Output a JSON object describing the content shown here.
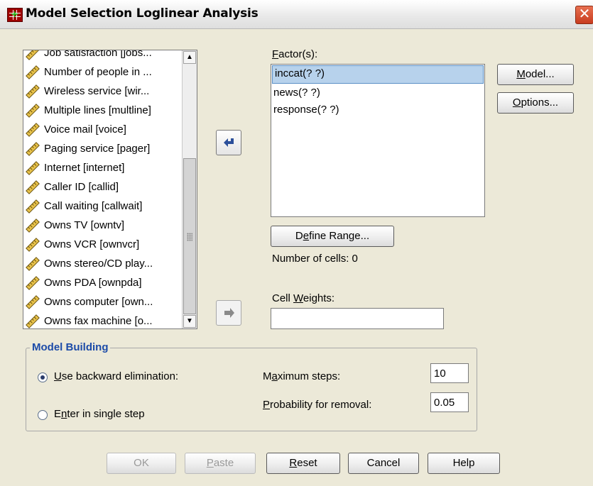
{
  "window": {
    "title": "Model Selection Loglinear Analysis",
    "close_glyph": "✕"
  },
  "variables": [
    {
      "label": "Job satisfaction [jobs...",
      "icon": "ruler-icon"
    },
    {
      "label": "Number of people in ...",
      "icon": "ruler-icon"
    },
    {
      "label": "Wireless service [wir...",
      "icon": "ruler-icon"
    },
    {
      "label": "Multiple lines [multline]",
      "icon": "ruler-icon"
    },
    {
      "label": "Voice mail [voice]",
      "icon": "ruler-icon"
    },
    {
      "label": "Paging service [pager]",
      "icon": "ruler-icon"
    },
    {
      "label": "Internet [internet]",
      "icon": "ruler-icon"
    },
    {
      "label": "Caller ID [callid]",
      "icon": "ruler-icon"
    },
    {
      "label": "Call waiting [callwait]",
      "icon": "ruler-icon"
    },
    {
      "label": "Owns TV [owntv]",
      "icon": "ruler-icon"
    },
    {
      "label": "Owns VCR [ownvcr]",
      "icon": "ruler-icon"
    },
    {
      "label": "Owns stereo/CD play...",
      "icon": "ruler-icon"
    },
    {
      "label": "Owns PDA [ownpda]",
      "icon": "ruler-icon"
    },
    {
      "label": "Owns computer [own...",
      "icon": "ruler-icon"
    },
    {
      "label": "Owns fax machine [o...",
      "icon": "ruler-icon"
    }
  ],
  "factors": {
    "label_mnemonic": "F",
    "label_rest": "actor(s):",
    "items": [
      "inccat(? ?)",
      "news(? ?)",
      "response(? ?)"
    ],
    "selected_index": 0
  },
  "define_range": {
    "pre": "D",
    "mn": "e",
    "post": "fine Range..."
  },
  "cells": {
    "text": "Number of cells:  0"
  },
  "cell_weights": {
    "pre": "Cell ",
    "mn": "W",
    "post": "eights:",
    "value": ""
  },
  "side_buttons": {
    "model": {
      "mn": "M",
      "post": "odel..."
    },
    "options": {
      "mn": "O",
      "post": "ptions..."
    }
  },
  "model_building": {
    "title": "Model Building",
    "backward": {
      "mn": "U",
      "post": "se backward elimination:",
      "selected": true
    },
    "single": {
      "pre": "E",
      "mn": "n",
      "post": "ter in single step",
      "selected": false
    },
    "max_steps": {
      "pre": "M",
      "mn": "a",
      "post": "ximum steps:",
      "value": "10"
    },
    "prob_removal": {
      "mn": "P",
      "post": "robability for removal:",
      "value": "0.05"
    }
  },
  "bottom_buttons": {
    "ok": "OK",
    "paste": {
      "mn": "P",
      "post": "aste"
    },
    "reset": {
      "mn": "R",
      "post": "eset"
    },
    "cancel": "Cancel",
    "help": "Help"
  }
}
